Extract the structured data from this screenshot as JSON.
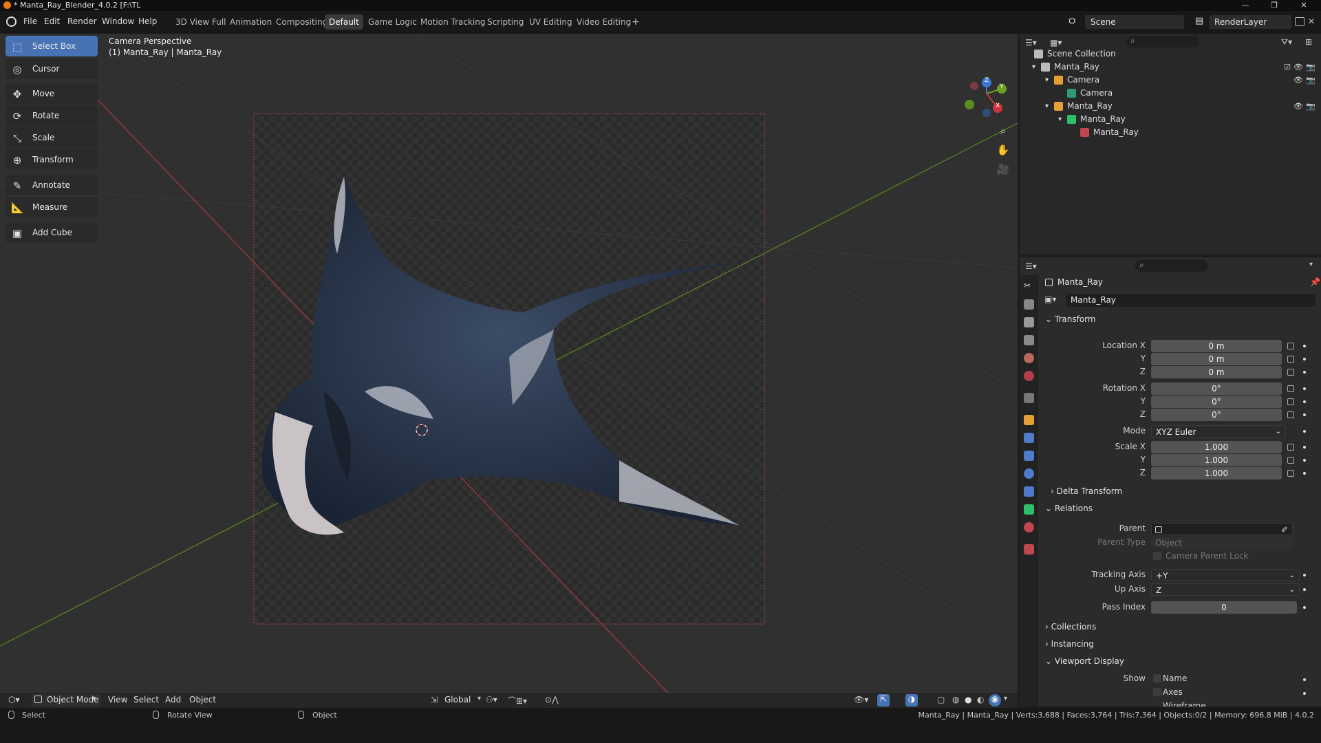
{
  "window": {
    "title": "* Manta_Ray_Blender_4.0.2 [F:\\TL",
    "controls": [
      "—",
      "❐",
      "✕"
    ]
  },
  "menu": {
    "items": [
      "File",
      "Edit",
      "Render",
      "Window",
      "Help"
    ],
    "workspaces": [
      "3D View Full",
      "Animation",
      "Compositing",
      "Default",
      "Game Logic",
      "Motion Tracking",
      "Scripting",
      "UV Editing",
      "Video Editing"
    ],
    "active_workspace": "Default",
    "add_workspace": "+",
    "scene": "Scene",
    "render_layer": "RenderLayer"
  },
  "viewport": {
    "view_name": "Camera Perspective",
    "object_info": "(1) Manta_Ray | Manta_Ray",
    "tools": [
      {
        "label": "Select Box",
        "icon": "select-box-icon",
        "glyph": "⬚"
      },
      {
        "label": "Cursor",
        "icon": "cursor-icon",
        "glyph": "◎"
      },
      {
        "label": "Move",
        "icon": "move-icon",
        "glyph": "✥"
      },
      {
        "label": "Rotate",
        "icon": "rotate-icon",
        "glyph": "⟳"
      },
      {
        "label": "Scale",
        "icon": "scale-icon",
        "glyph": "⤡"
      },
      {
        "label": "Transform",
        "icon": "transform-icon",
        "glyph": "⊕"
      },
      {
        "label": "Annotate",
        "icon": "annotate-icon",
        "glyph": "✎"
      },
      {
        "label": "Measure",
        "icon": "measure-icon",
        "glyph": "📐"
      },
      {
        "label": "Add Cube",
        "icon": "add-cube-icon",
        "glyph": "▣"
      }
    ],
    "gizmo_axes": [
      "Z",
      "Y",
      "X"
    ]
  },
  "viewport_header": {
    "mode": "Object Mode",
    "menus": [
      "View",
      "Select",
      "Add",
      "Object"
    ],
    "transform_orientation": "Global"
  },
  "outliner": {
    "root": "Scene Collection",
    "rows": [
      {
        "label": "Manta_Ray",
        "indent": 1,
        "icon": "collection-icon",
        "color": "#bdbdbd",
        "arrow": "▾"
      },
      {
        "label": "Camera",
        "indent": 2,
        "icon": "camera-object-icon",
        "color": "#e69e35",
        "arrow": "▾"
      },
      {
        "label": "Camera",
        "indent": 3,
        "icon": "camera-data-icon",
        "color": "#2f9a7a",
        "arrow": ""
      },
      {
        "label": "Manta_Ray",
        "indent": 2,
        "icon": "mesh-object-icon",
        "color": "#e69e35",
        "arrow": "▾"
      },
      {
        "label": "Manta_Ray",
        "indent": 3,
        "icon": "mesh-data-icon",
        "color": "#2fbf6a",
        "arrow": "▾"
      },
      {
        "label": "Manta_Ray",
        "indent": 4,
        "icon": "material-icon",
        "color": "#c0474f",
        "arrow": ""
      }
    ]
  },
  "properties": {
    "object_name": "Manta_Ray",
    "datablock_name": "Manta_Ray",
    "sections": {
      "transform": "Transform",
      "delta_transform": "Delta Transform",
      "relations": "Relations",
      "collections": "Collections",
      "instancing": "Instancing",
      "viewport_display": "Viewport Display"
    },
    "location": {
      "label": "Location X",
      "x": "0 m",
      "y": "0 m",
      "z": "0 m"
    },
    "rotation": {
      "label": "Rotation X",
      "x": "0°",
      "y": "0°",
      "z": "0°"
    },
    "mode": {
      "label": "Mode",
      "value": "XYZ Euler"
    },
    "scale": {
      "label": "Scale X",
      "x": "1.000",
      "y": "1.000",
      "z": "1.000"
    },
    "axis_labels": {
      "y": "Y",
      "z": "Z"
    },
    "relations": {
      "parent_label": "Parent",
      "parent_type_label": "Parent Type",
      "parent_type_value": "Object",
      "parent_lock_label": "Camera Parent Lock",
      "tracking_axis_label": "Tracking Axis",
      "tracking_axis_value": "+Y",
      "up_axis_label": "Up Axis",
      "up_axis_value": "Z",
      "pass_index_label": "Pass Index",
      "pass_index_value": "0"
    },
    "viewport_display": {
      "show_label": "Show",
      "name_label": "Name",
      "axes_label": "Axes",
      "wireframe_label": "Wireframe"
    }
  },
  "status_bar": {
    "left": [
      {
        "label": "Select"
      },
      {
        "label": "Rotate View"
      },
      {
        "label": "Object"
      }
    ],
    "right": "Manta_Ray | Manta_Ray | Verts:3,688 | Faces:3,764 | Tris:7,364 | Objects:0/2 | Memory: 696.8 MiB | 4.0.2"
  },
  "colors": {
    "accent": "#4772b3",
    "blender_orange": "#e87d0d",
    "x_axis": "#c8353f",
    "y_axis": "#6da027",
    "z_axis": "#3b78d6"
  }
}
